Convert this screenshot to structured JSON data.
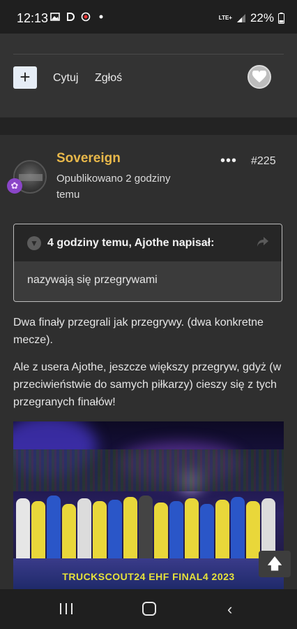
{
  "status_bar": {
    "time": "12:13",
    "network": "LTE+",
    "battery": "22%"
  },
  "prev_post": {
    "cite_label": "Cytuj",
    "report_label": "Zgłoś",
    "plus_label": "+"
  },
  "post": {
    "author": "Sovereign",
    "published": "Opublikowano 2 godziny temu",
    "menu": "•••",
    "number": "#225",
    "quote": {
      "header": "4 godziny temu, Ajothe napisał:",
      "body": "nazywają się przegrywami"
    },
    "paragraphs": [
      "Dwa finały przegrali jak przegrywy. (dwa konkretne mecze).",
      "Ale z usera Ajothe, jeszcze większy przegryw, gdyż (w przeciwieństwie do samych piłkarzy) cieszy się z tych przegranych finałów!"
    ],
    "photo_banner": "TRUCKSCOUT24 EHF FINAL4 2023"
  },
  "colors": {
    "author": "#e8b84a",
    "badge": "#8a45c8",
    "background": "#2f2f2f"
  }
}
